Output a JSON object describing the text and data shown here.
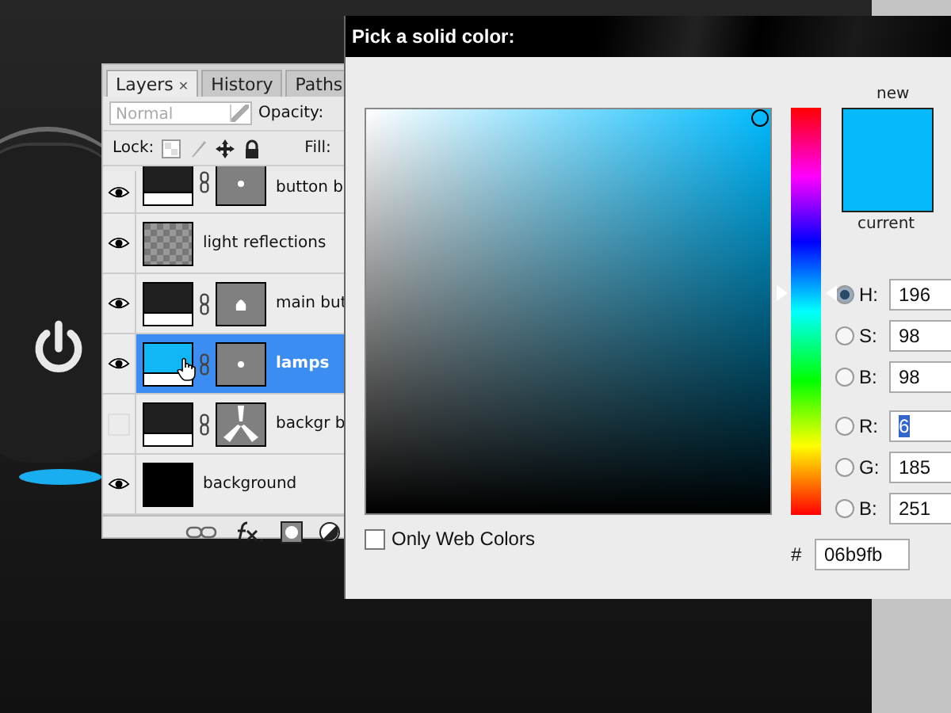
{
  "layers_panel": {
    "tabs": [
      {
        "label": "Layers",
        "selected": true,
        "close_icon": "✕"
      },
      {
        "label": "History",
        "selected": false
      },
      {
        "label": "Paths",
        "selected": false
      }
    ],
    "blend_mode": {
      "value": "Normal",
      "disabled": true
    },
    "opacity_label": "Opacity:",
    "lock_label": "Lock:",
    "fill_label": "Fill:",
    "layers": [
      {
        "name": "button b",
        "visible": true,
        "thumbnail": {
          "kind": "dark"
        },
        "mask": {
          "kind": "dot"
        },
        "selected": false
      },
      {
        "name": "light reflections",
        "visible": true,
        "thumbnail": {
          "kind": "checker"
        },
        "selected": false
      },
      {
        "name": "main but",
        "visible": true,
        "thumbnail": {
          "kind": "dark"
        },
        "mask": {
          "kind": "blob"
        },
        "selected": false
      },
      {
        "name": "lamps",
        "visible": true,
        "thumbnail": {
          "kind": "cyan"
        },
        "mask": {
          "kind": "dot"
        },
        "selected": true
      },
      {
        "name": "backgr b",
        "visible": false,
        "thumbnail": {
          "kind": "dark"
        },
        "mask": {
          "kind": "trefoil"
        },
        "selected": false
      },
      {
        "name": "background",
        "visible": true,
        "thumbnail": {
          "kind": "black"
        },
        "selected": false
      }
    ]
  },
  "color_picker": {
    "title": "Pick a solid color:",
    "new_label": "new",
    "current_label": "current",
    "hue_slider": {
      "level": 0.545
    },
    "fields": [
      {
        "label": "H:",
        "value": "196",
        "selected": true,
        "highlighted": false
      },
      {
        "label": "S:",
        "value": "98",
        "selected": false,
        "highlighted": false
      },
      {
        "label": "B:",
        "value": "98",
        "selected": false,
        "highlighted": false
      },
      {
        "label": "R:",
        "value": "6",
        "selected": false,
        "highlighted": true
      },
      {
        "label": "G:",
        "value": "185",
        "selected": false,
        "highlighted": false
      },
      {
        "label": "B:",
        "value": "251",
        "selected": false,
        "highlighted": false
      }
    ],
    "hex_label": "#",
    "hex": "06b9fb",
    "web_colors": {
      "label": "Only Web Colors",
      "checked": false
    }
  }
}
